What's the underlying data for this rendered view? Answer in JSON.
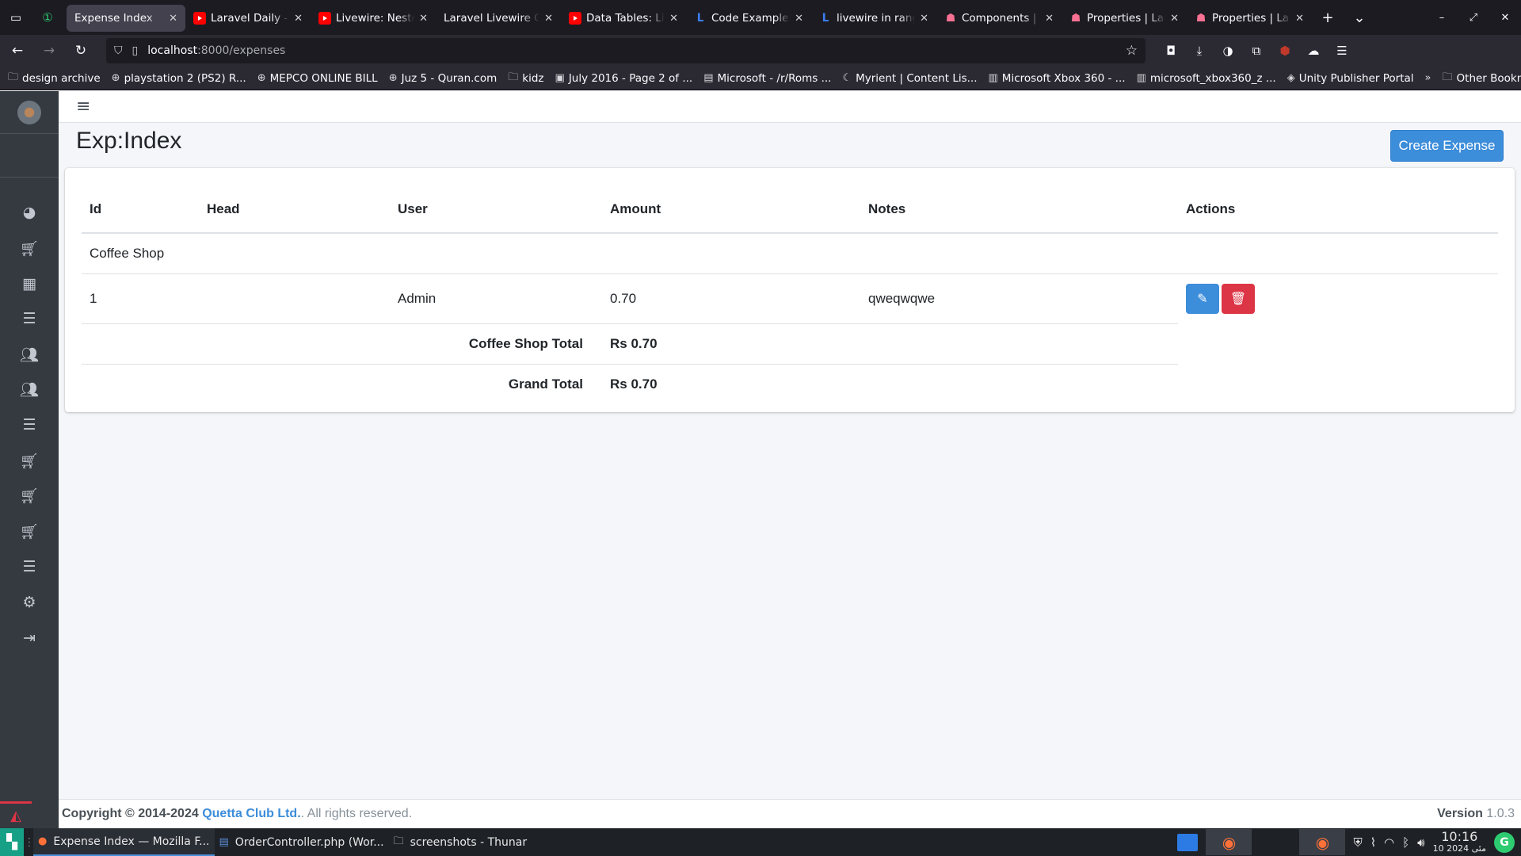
{
  "browser": {
    "tabs": [
      {
        "label": "Expense Index",
        "icon": "page-icon",
        "active": true
      },
      {
        "label": "Laravel Daily - YouTube",
        "icon": "youtube-icon"
      },
      {
        "label": "Livewire: Nested",
        "icon": "youtube-icon"
      },
      {
        "label": "Laravel Livewire Co",
        "icon": "none"
      },
      {
        "label": "Data Tables: Livewire",
        "icon": "youtube-icon"
      },
      {
        "label": "Code Examples",
        "icon": "livewire-icon"
      },
      {
        "label": "livewire in range",
        "icon": "livewire-icon"
      },
      {
        "label": "Components | L",
        "icon": "ghost-icon"
      },
      {
        "label": "Properties | Lara",
        "icon": "ghost-icon"
      },
      {
        "label": "Properties | Lara",
        "icon": "ghost-icon"
      }
    ],
    "url_host": "localhost",
    "url_path": ":8000/expenses",
    "bookmarks": [
      {
        "label": "design archive",
        "icon": "folder-icon"
      },
      {
        "label": "playstation 2 (PS2) R...",
        "icon": "globe-icon"
      },
      {
        "label": "MEPCO ONLINE BILL",
        "icon": "globe-icon"
      },
      {
        "label": "Juz 5 - Quran.com",
        "icon": "globe-icon"
      },
      {
        "label": "kidz",
        "icon": "folder-icon"
      },
      {
        "label": "July 2016 - Page 2 of ...",
        "icon": "image-icon"
      },
      {
        "label": "Microsoft - /r/Roms ...",
        "icon": "page-icon"
      },
      {
        "label": "Myrient | Content Lis...",
        "icon": "moon-icon"
      },
      {
        "label": "Microsoft Xbox 360 - ...",
        "icon": "archive-icon"
      },
      {
        "label": "microsoft_xbox360_z ...",
        "icon": "archive-icon"
      },
      {
        "label": "Unity Publisher Portal",
        "icon": "unity-icon"
      }
    ],
    "other_bookmarks": "Other Bookmarks"
  },
  "app": {
    "title": "Exp:Index",
    "create_button": "Create Expense",
    "table": {
      "headers": [
        "Id",
        "Head",
        "User",
        "Amount",
        "Notes",
        "Actions"
      ],
      "group_name": "Coffee Shop",
      "rows": [
        {
          "id": "1",
          "head": "",
          "user": "Admin",
          "amount": "0.70",
          "notes": "qweqwqwe"
        }
      ],
      "group_total_label": "Coffee Shop Total",
      "group_total_value": "Rs 0.70",
      "grand_total_label": "Grand Total",
      "grand_total_value": "Rs 0.70"
    },
    "footer": {
      "copyright": "Copyright © 2014-2024",
      "company": "Quetta Club Ltd.",
      "rights": ". All rights reserved.",
      "version_label": "Version",
      "version_value": "1.0.3"
    },
    "colors": {
      "primary": "#3c8dda",
      "danger": "#dc3545",
      "sidebar": "#343a40"
    }
  },
  "taskbar": {
    "tasks": [
      {
        "label": "Expense Index — Mozilla F...",
        "icon": "firefox-icon",
        "active": true
      },
      {
        "label": "OrderController.php (Wor...",
        "icon": "editor-icon"
      },
      {
        "label": "screenshots - Thunar",
        "icon": "folder-icon"
      }
    ],
    "time": "10:16",
    "date": "10 مئی 2024"
  }
}
